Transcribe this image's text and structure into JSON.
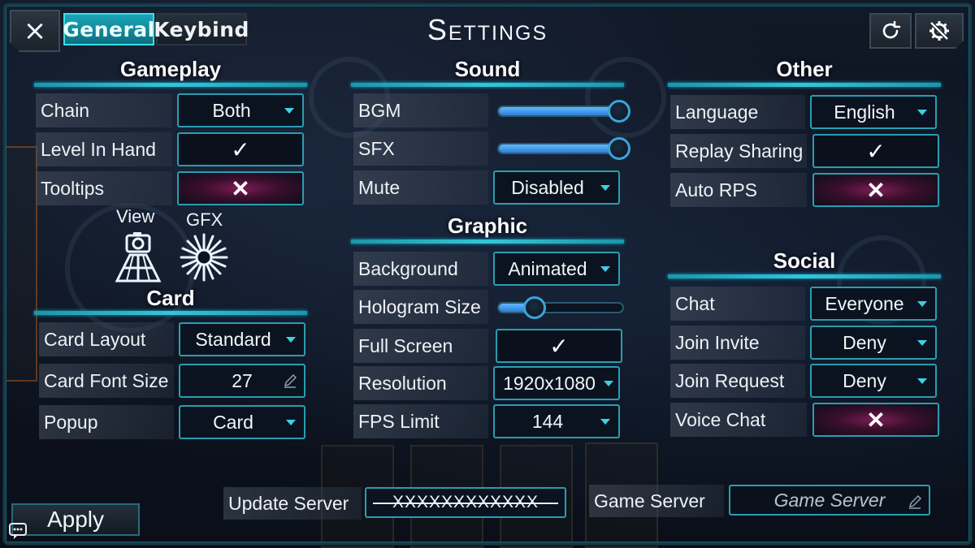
{
  "topbar": {
    "close_icon": "×",
    "tabs": [
      {
        "label": "General",
        "active": true
      },
      {
        "label": "Keybind",
        "active": false
      }
    ],
    "title": "Settings"
  },
  "gameplay": {
    "title": "Gameplay",
    "chain": {
      "label": "Chain",
      "value": "Both"
    },
    "level_in_hand": {
      "label": "Level In Hand",
      "mark": "✓"
    },
    "tooltips": {
      "label": "Tooltips",
      "mark": "✕"
    },
    "view_label": "View",
    "gfx_label": "GFX"
  },
  "card": {
    "title": "Card",
    "card_layout": {
      "label": "Card Layout",
      "value": "Standard"
    },
    "card_font_size": {
      "label": "Card Font Size",
      "value": "27"
    },
    "popup": {
      "label": "Popup",
      "value": "Card"
    }
  },
  "sound": {
    "title": "Sound",
    "bgm": {
      "label": "BGM",
      "level": 1.0
    },
    "sfx": {
      "label": "SFX",
      "level": 1.0
    },
    "mute": {
      "label": "Mute",
      "value": "Disabled"
    }
  },
  "graphic": {
    "title": "Graphic",
    "background": {
      "label": "Background",
      "value": "Animated"
    },
    "hologram_size": {
      "label": "Hologram Size",
      "level": 0.3
    },
    "full_screen": {
      "label": "Full Screen",
      "mark": "✓"
    },
    "resolution": {
      "label": "Resolution",
      "value": "1920x1080"
    },
    "fps_limit": {
      "label": "FPS Limit",
      "value": "144"
    }
  },
  "other": {
    "title": "Other",
    "language": {
      "label": "Language",
      "value": "English"
    },
    "replay_sharing": {
      "label": "Replay Sharing",
      "mark": "✓"
    },
    "auto_rps": {
      "label": "Auto RPS",
      "mark": "✕"
    }
  },
  "social": {
    "title": "Social",
    "chat": {
      "label": "Chat",
      "value": "Everyone"
    },
    "join_invite": {
      "label": "Join Invite",
      "value": "Deny"
    },
    "join_request": {
      "label": "Join Request",
      "value": "Deny"
    },
    "voice_chat": {
      "label": "Voice Chat",
      "mark": "✕"
    }
  },
  "servers": {
    "update_label": "Update Server",
    "update_value": "XXXXXXXXXXXX",
    "game_label": "Game Server",
    "game_placeholder": "Game Server"
  },
  "footer": {
    "apply_label": "Apply"
  },
  "colors": {
    "accent": "#2a9db0",
    "toggle_off": "#7a1d55",
    "slider_fill": "#3f95ee"
  }
}
